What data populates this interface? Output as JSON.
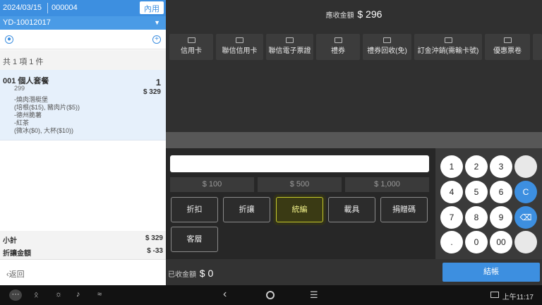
{
  "left": {
    "date": "2024/03/15",
    "order_no": "000004",
    "dine_type": "內用",
    "order_id": "YD-10012017",
    "summary": "共 1 項 1 件",
    "item": {
      "name": "001 個人套餐",
      "code": "299",
      "qty": "1",
      "price": "$ 329",
      "mods": [
        "-燒肉潛艇堡",
        "(培根($15), 豬肉片($5))",
        "-德州脆薯",
        "-紅茶",
        "(微冰($0), 大杯($10))"
      ]
    },
    "subtotal_label": "小計",
    "subtotal_value": "$ 329",
    "discount_label": "折讓金額",
    "discount_value": "$ -33",
    "back_label": "返回"
  },
  "right": {
    "due_label": "應收金額",
    "due_amount": "$ 296",
    "payment_methods": [
      "信用卡",
      "聯信信用卡",
      "聯信電子票證",
      "禮券",
      "禮券回收(免)",
      "訂金沖銷(需輸卡號)",
      "優惠票卷"
    ],
    "quick_amounts": [
      "$ 100",
      "$ 500",
      "$ 1,000"
    ],
    "functions": [
      "折扣",
      "折讓",
      "統編",
      "載具",
      "捐贈碼",
      "客層"
    ],
    "keypad": [
      "1",
      "2",
      "3",
      "",
      "4",
      "5",
      "6",
      "C",
      "7",
      "8",
      "9",
      "⌫",
      ".",
      "0",
      "00",
      ""
    ],
    "paid_label": "已收金額",
    "paid_amount": "$ 0",
    "checkout_label": "結帳"
  },
  "navbar": {
    "clock": "上午11:17"
  },
  "colors": {
    "accent": "#3d8fe0",
    "highlight": "#c8cc2b"
  }
}
